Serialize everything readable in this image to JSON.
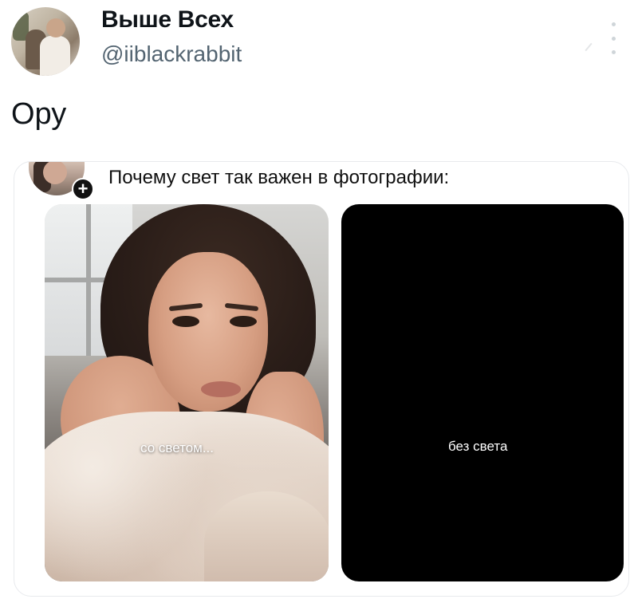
{
  "tweet": {
    "author": {
      "display_name": "Выше Всех",
      "handle": "@iiblackrabbit"
    },
    "text": "Ору",
    "more_icon": "vertical-ellipsis-icon"
  },
  "embedded_meme": {
    "title": "Почему свет так важен в фотографии:",
    "follow_icon": "plus-icon",
    "follow_symbol": "+",
    "panels": [
      {
        "caption": "со светом...",
        "background": "photo"
      },
      {
        "caption": "без света",
        "background": "#000000"
      }
    ]
  }
}
